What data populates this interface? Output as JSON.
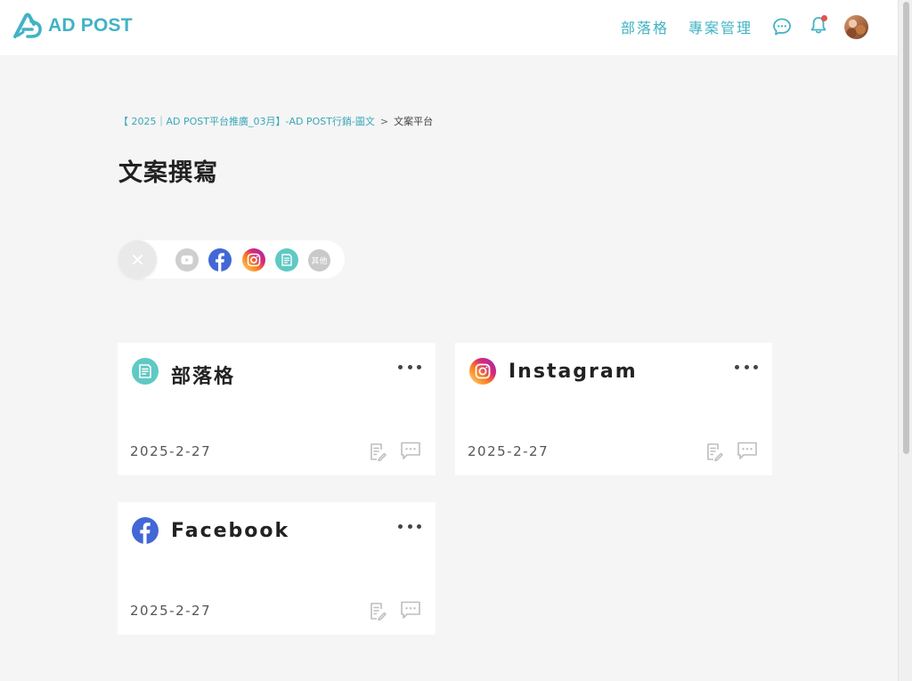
{
  "header": {
    "logo_text": "AD POST",
    "nav": {
      "blog": "部落格",
      "project": "專案管理"
    },
    "icons": [
      "chat-bubble-icon",
      "bell-icon",
      "avatar"
    ],
    "accent_color": "#41b3c4",
    "notification_dot_color": "#e5534b"
  },
  "breadcrumb": {
    "parent": "【 2025｜AD POST平台推廣_03月】-AD POST行銷-圖文",
    "separator": ">",
    "current": "文案平台"
  },
  "page": {
    "title": "文案撰寫"
  },
  "filters": {
    "clear_symbol": "✕",
    "chips": [
      "youtube-icon",
      "facebook-icon",
      "instagram-icon",
      "blog-icon"
    ],
    "other_label": "其他"
  },
  "cards": [
    {
      "platform": "blog",
      "title": "部落格",
      "date": "2025-2-27"
    },
    {
      "platform": "instagram",
      "title": "Instagram",
      "date": "2025-2-27"
    },
    {
      "platform": "facebook",
      "title": "Facebook",
      "date": "2025-2-27"
    }
  ],
  "colors": {
    "facebook": "#4267d6",
    "blog": "#5fc9c4",
    "instagram_gradient": [
      "#feda75",
      "#d62976",
      "#962fbf"
    ]
  }
}
